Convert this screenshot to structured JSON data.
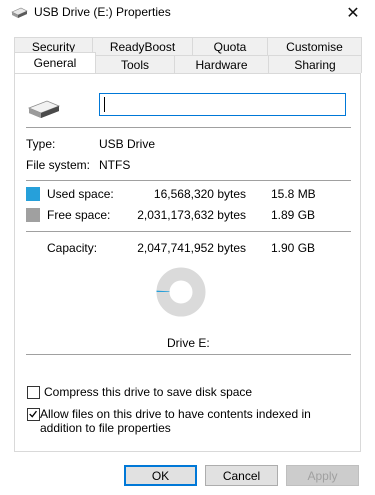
{
  "window": {
    "title": "USB Drive (E:) Properties",
    "close_glyph": "✕"
  },
  "tabs": {
    "row1": [
      "Security",
      "ReadyBoost",
      "Quota",
      "Customise"
    ],
    "row2": [
      "General",
      "Tools",
      "Hardware",
      "Sharing"
    ],
    "active": "General"
  },
  "general": {
    "drive_name_value": "",
    "type_label": "Type:",
    "type_value": "USB Drive",
    "fs_label": "File system:",
    "fs_value": "NTFS",
    "used_label": "Used space:",
    "used_bytes": "16,568,320 bytes",
    "used_size": "15.8 MB",
    "free_label": "Free space:",
    "free_bytes": "2,031,173,632 bytes",
    "free_size": "1.89 GB",
    "capacity_label": "Capacity:",
    "capacity_bytes": "2,047,741,952 bytes",
    "capacity_size": "1.90 GB",
    "drive_caption": "Drive E:",
    "used_fraction": 0.0081,
    "used_color": "#26a0da",
    "free_color": "#a0a0a0"
  },
  "options": {
    "compress_label": "Compress this drive to save disk space",
    "compress_checked": false,
    "index_label": "Allow files on this drive to have contents indexed in addition to file properties",
    "index_checked": true
  },
  "buttons": {
    "ok": "OK",
    "cancel": "Cancel",
    "apply": "Apply"
  },
  "icons": {
    "title": "usb-drive-icon",
    "drive": "usb-drive-icon",
    "close": "close-icon",
    "check": "checkmark-icon"
  }
}
